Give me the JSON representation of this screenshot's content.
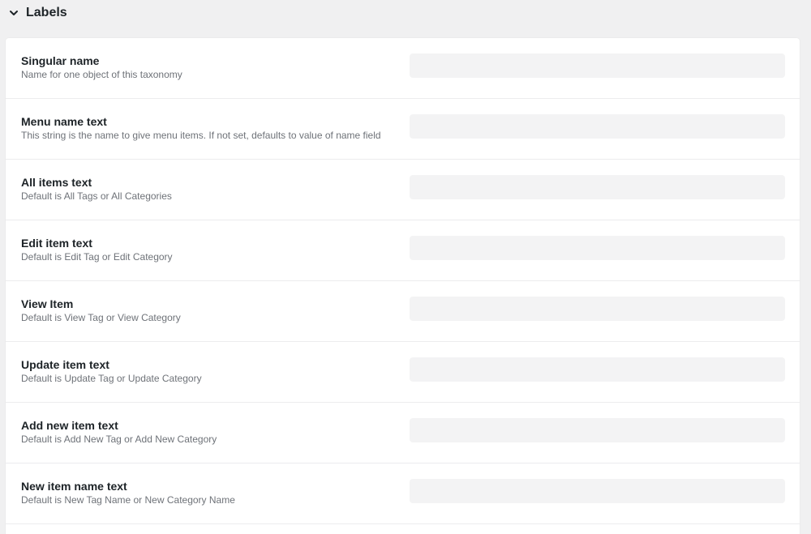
{
  "section": {
    "title": "Labels",
    "icon": "chevron-down-icon"
  },
  "fields": [
    {
      "label": "Singular name",
      "description": "Name for one object of this taxonomy",
      "value": ""
    },
    {
      "label": "Menu name text",
      "description": "This string is the name to give menu items. If not set, defaults to value of name field",
      "value": ""
    },
    {
      "label": "All items text",
      "description": "Default is All Tags or All Categories",
      "value": ""
    },
    {
      "label": "Edit item text",
      "description": "Default is Edit Tag or Edit Category",
      "value": ""
    },
    {
      "label": "View Item",
      "description": "Default is View Tag or View Category",
      "value": ""
    },
    {
      "label": "Update item text",
      "description": "Default is Update Tag or Update Category",
      "value": ""
    },
    {
      "label": "Add new item text",
      "description": "Default is Add New Tag or Add New Category",
      "value": ""
    },
    {
      "label": "New item name text",
      "description": "Default is New Tag Name or New Category Name",
      "value": ""
    }
  ],
  "colors": {
    "background": "#f0f0f1",
    "card": "#ffffff",
    "input_fill": "#f3f3f4",
    "label_text": "#1d2327",
    "description_text": "#6e7278"
  }
}
